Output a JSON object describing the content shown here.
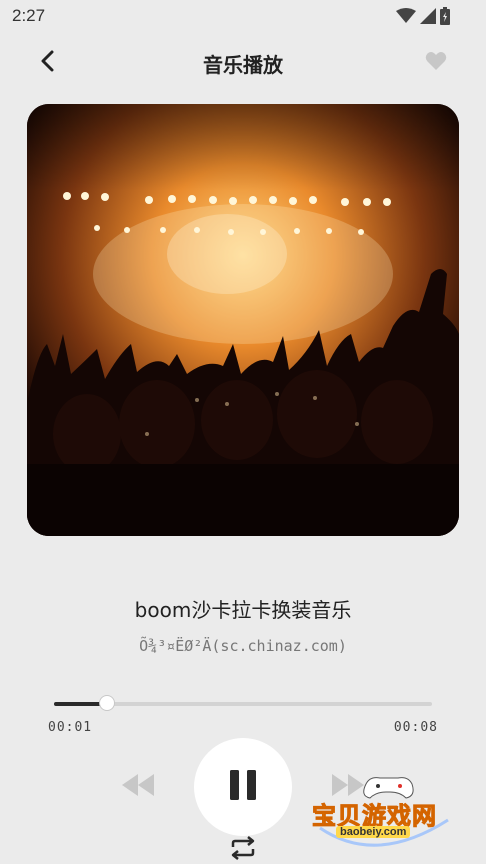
{
  "status_bar": {
    "time": "2:27",
    "icons": [
      "wifi-icon",
      "signal-icon",
      "battery-icon"
    ]
  },
  "header": {
    "title": "音乐播放",
    "back_icon": "chevron-left-icon",
    "favorite_icon": "heart-icon"
  },
  "cover": {
    "description_icon": "album-cover-image"
  },
  "track": {
    "title": "boom沙卡拉卡换装音乐",
    "artist": "Õ¾³¤ËØ²Ä(sc.chinaz.com)"
  },
  "progress": {
    "current": "00:01",
    "total": "00:08",
    "fraction": 0.14
  },
  "controls": {
    "prev_icon": "rewind-icon",
    "play_icon": "pause-icon",
    "next_icon": "fast-forward-icon",
    "repeat_icon": "repeat-icon"
  },
  "watermark": {
    "text": "宝贝游戏网",
    "sub": "baobeiy.com"
  },
  "colors": {
    "background": "#ebebeb",
    "accent": "#2a2a2a",
    "track": "#d3d3d3",
    "controls_inactive": "#c7c7c7"
  }
}
